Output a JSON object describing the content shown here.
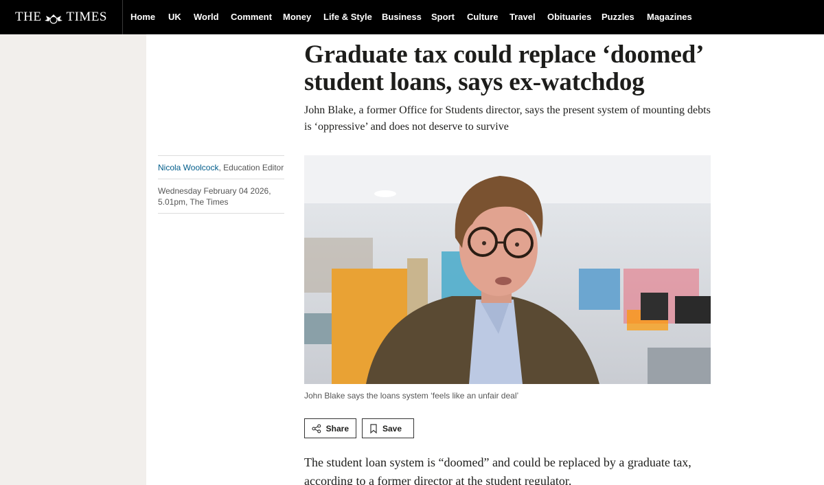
{
  "masthead": {
    "logo_left": "THE",
    "logo_right": "TIMES",
    "nav": [
      "Home",
      "UK",
      "World",
      "Comment",
      "Money",
      "Life & Style",
      "Business",
      "Sport",
      "Culture",
      "Travel",
      "Obituaries",
      "Puzzles",
      "Magazines"
    ]
  },
  "article": {
    "headline": "Graduate tax could replace ‘doomed’ student loans, says ex-watchdog",
    "standfirst": "John Blake, a former Office for Students director, says the present system of mounting debts is ‘oppressive’ and does not deserve to survive",
    "author_name": "Nicola Woolcock",
    "author_role": ", Education Editor",
    "date": "Wednesday February 04 2026, 5.01pm, The Times",
    "caption": "John Blake says the loans system ‘feels like an unfair deal’",
    "share_label": "Share",
    "save_label": "Save",
    "body_first": "The student loan system is “doomed” and could be replaced by a graduate tax, according to a former director at the student regulator."
  },
  "icons": {
    "share": "share-icon",
    "save": "bookmark-icon"
  }
}
